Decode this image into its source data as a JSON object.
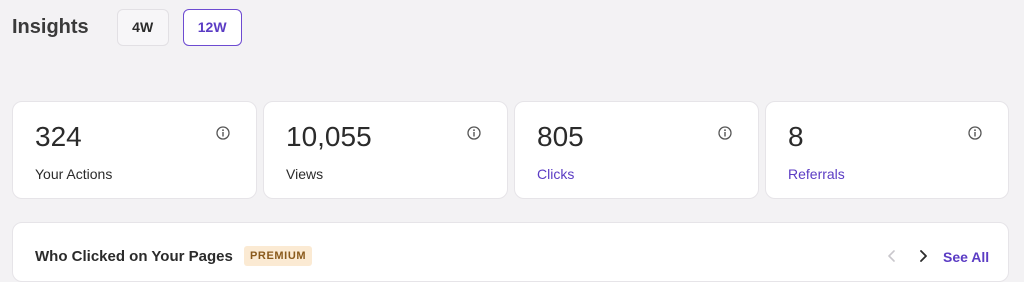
{
  "header": {
    "title": "Insights",
    "ranges": [
      {
        "label": "4W",
        "active": false
      },
      {
        "label": "12W",
        "active": true
      }
    ]
  },
  "stats": [
    {
      "value": "324",
      "label": "Your Actions",
      "label_is_link": false
    },
    {
      "value": "10,055",
      "label": "Views",
      "label_is_link": false
    },
    {
      "value": "805",
      "label": "Clicks",
      "label_is_link": true
    },
    {
      "value": "8",
      "label": "Referrals",
      "label_is_link": true
    }
  ],
  "clicks_section": {
    "title": "Who Clicked on Your Pages",
    "badge": "PREMIUM",
    "see_all_label": "See All"
  },
  "icons": {
    "info": "info-icon",
    "prev": "chevron-left-icon",
    "next": "chevron-right-icon"
  },
  "colors": {
    "accent": "#5b3cc4",
    "background": "#f3f2f4",
    "card": "#ffffff",
    "badge_bg": "#fbead3",
    "badge_text": "#8a5a1c",
    "prev_disabled": "#c9c7cc"
  }
}
